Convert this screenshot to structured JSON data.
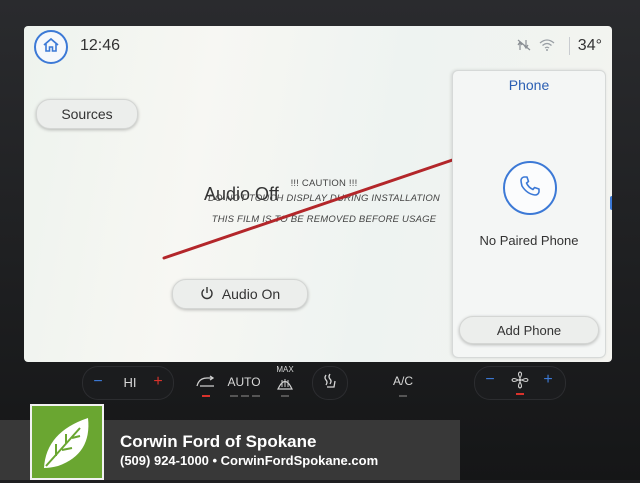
{
  "status": {
    "time": "12:46",
    "temperature": "34°",
    "icons": [
      "home-icon",
      "no-signal-icon",
      "wifi-icon"
    ]
  },
  "audio": {
    "sources_label": "Sources",
    "state_label": "Audio Off",
    "audio_on_label": "Audio On"
  },
  "film_notice": {
    "line1": "!!! CAUTION !!!",
    "line2": "DO NOT TOUCH DISPLAY DURING INSTALLATION",
    "line3": "THIS FILM IS TO BE REMOVED BEFORE USAGE",
    "line_color": "#b3262a"
  },
  "phone": {
    "title": "Phone",
    "status": "No Paired Phone",
    "add_label": "Add Phone"
  },
  "climate": {
    "fan_mode": "HI",
    "auto_label": "AUTO",
    "max_label": "MAX",
    "ac_label": "A/C"
  },
  "dealer": {
    "name": "Corwin Ford of Spokane",
    "contact": "(509) 924-1000  • CorwinFordSpokane.com"
  },
  "colors": {
    "accent": "#3c79d6",
    "indicator_red": "#d9322b",
    "logo_green": "#6aa631"
  }
}
